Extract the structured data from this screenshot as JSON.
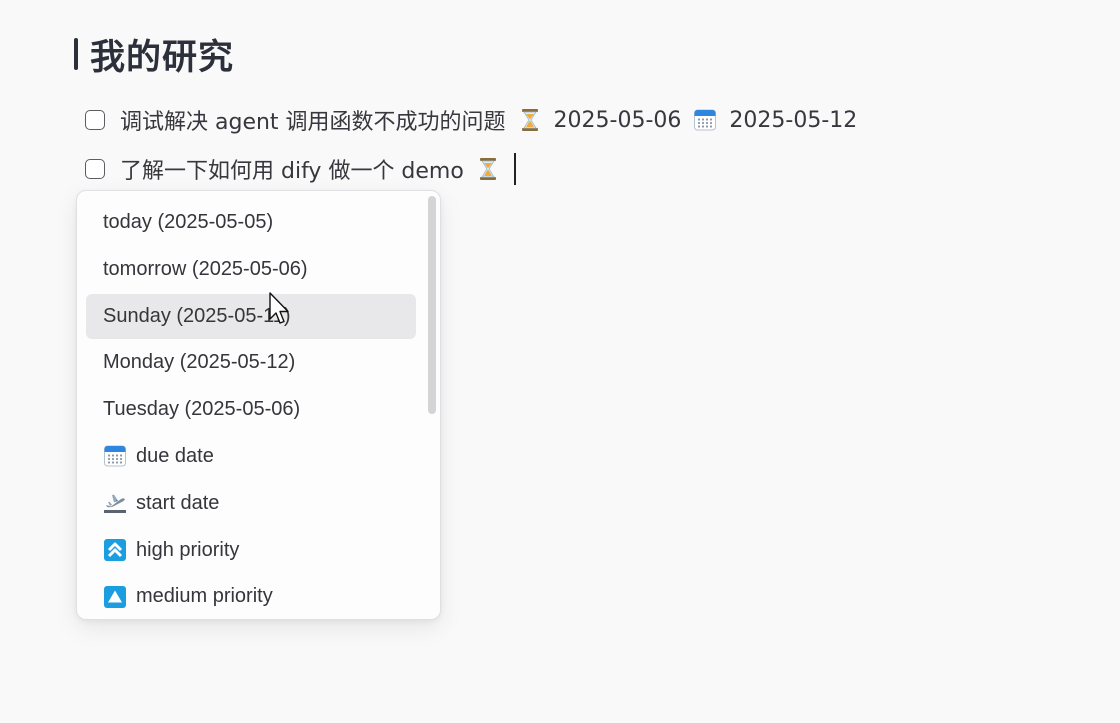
{
  "heading": {
    "title": "我的研究"
  },
  "tasks": [
    {
      "text": "调试解决 agent 调用函数不成功的问题",
      "scheduled_icon": "hourglass-icon",
      "scheduled_date": "2025-05-06",
      "due_icon": "calendar-icon",
      "due_date": "2025-05-12",
      "checked": false
    },
    {
      "text": "了解一下如何用 dify 做一个 demo",
      "scheduled_icon": "hourglass-icon",
      "checked": false
    }
  ],
  "suggestions": [
    {
      "label": "today (2025-05-05)"
    },
    {
      "label": "tomorrow (2025-05-06)"
    },
    {
      "label": "Sunday (2025-05-11)",
      "highlighted": true
    },
    {
      "label": "Monday (2025-05-12)"
    },
    {
      "label": "Tuesday (2025-05-06)"
    },
    {
      "label": "due date",
      "icon": "calendar-icon"
    },
    {
      "label": "start date",
      "icon": "airplane-departure-icon"
    },
    {
      "label": "high priority",
      "icon": "double-up-arrow-icon"
    },
    {
      "label": "medium priority",
      "icon": "up-triangle-icon"
    }
  ],
  "colors": {
    "background": "#f9f9fa",
    "highlight": "#e8e8ea",
    "priority_blue": "#1a9ee0",
    "calendar_blue": "#2e86de"
  }
}
